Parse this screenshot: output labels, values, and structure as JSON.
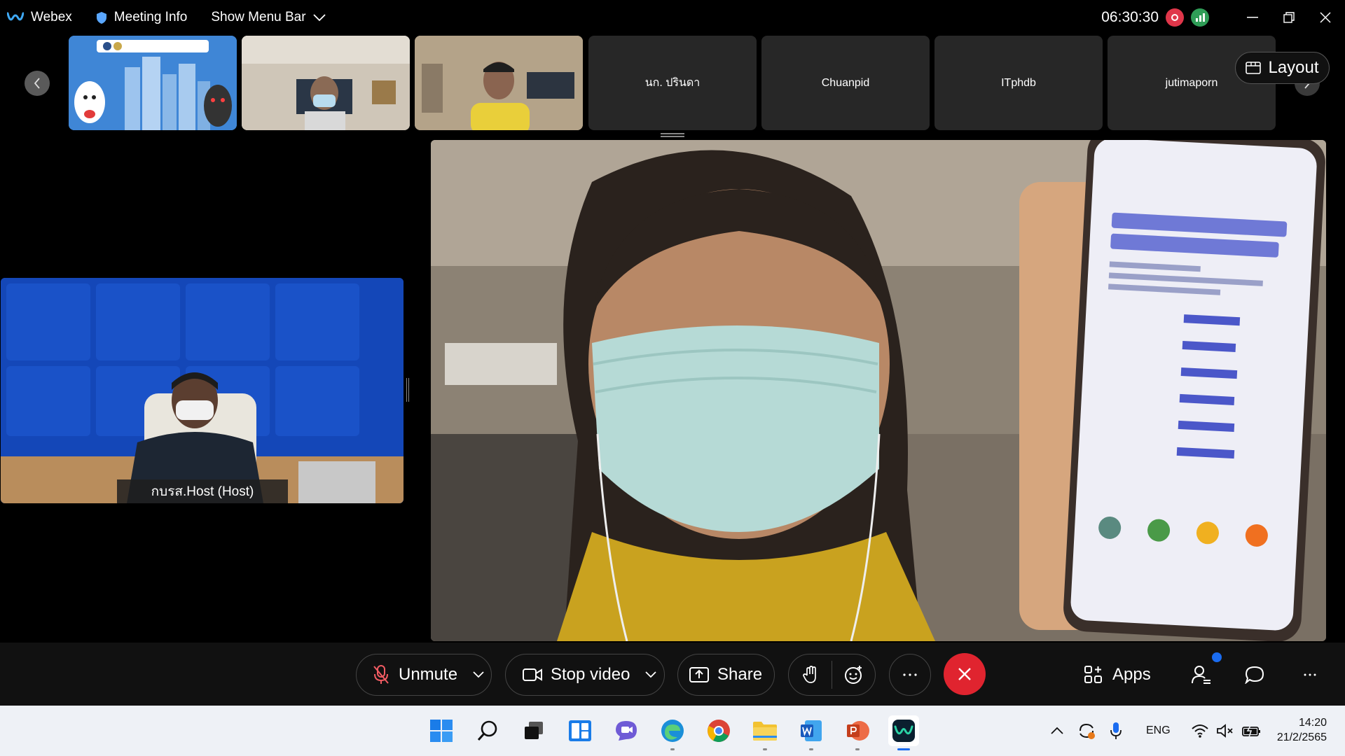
{
  "topbar": {
    "app_name": "Webex",
    "meeting_info": "Meeting Info",
    "show_menu_bar": "Show Menu Bar",
    "clock": "06:30:30"
  },
  "participants": {
    "thumb4_name": "นก. ปรินดา",
    "thumb5_name": "Chuanpid",
    "thumb6_name": "ITphdb",
    "thumb7_name": "jutimaporn",
    "host_name": "กบรส.Host (Host)"
  },
  "layout_label": "Layout",
  "controls": {
    "unmute": "Unmute",
    "stop_video": "Stop video",
    "share": "Share",
    "apps": "Apps"
  },
  "taskbar": {
    "language": "ENG",
    "time": "14:20",
    "date": "21/2/2565"
  },
  "colors": {
    "accent": "#1a6cf0",
    "end_call": "#e0242f",
    "recording": "#e0364a",
    "stats": "#2f9d57",
    "host_bg": "#1447b8"
  }
}
